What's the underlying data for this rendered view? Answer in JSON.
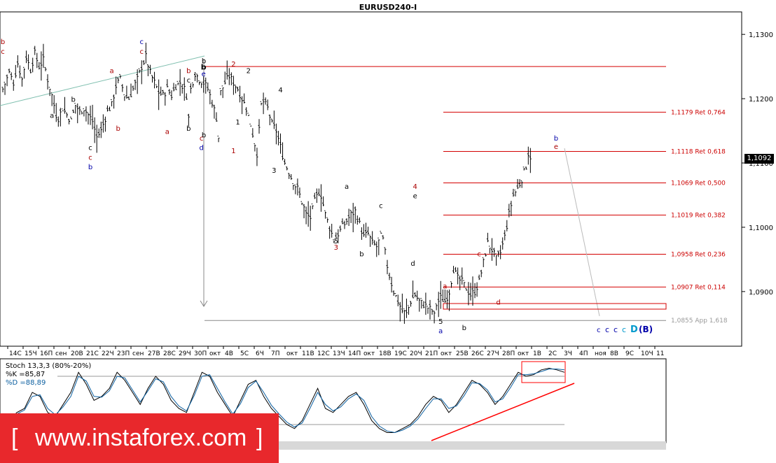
{
  "title": "EURUSD240-I",
  "current_price": "1,1092",
  "banner": {
    "left_bracket": "[",
    "url": "www.instaforex.com",
    "right_bracket": "]"
  },
  "colors": {
    "fib_line": "#d40000",
    "fib_label": "#cc0000",
    "wave_red": "#aa0000",
    "wave_blue": "#0000aa",
    "wave_cyan": "#0099cc",
    "trendline": "#ff0000",
    "channel": "#7fbfaf",
    "candle": "#000000",
    "stoch_k": "#000000",
    "stoch_d": "#0b5fa0",
    "banner_bg": "#e8282c"
  },
  "chart_data": [
    {
      "type": "candlestick",
      "title": "EURUSD240-I",
      "ylim": [
        1.0815,
        1.1335
      ],
      "y_ticks": [
        "1,1300",
        "1,1200",
        "1,1100",
        "1,1000",
        "1,0900"
      ],
      "x_ticks": [
        "14C",
        "15Ч",
        "16П",
        "сен",
        "20В",
        "21С",
        "22Ч",
        "23П",
        "сен",
        "27В",
        "28С",
        "29Ч",
        "30П",
        "окт",
        "4В",
        "5С",
        "6Ч",
        "7П",
        "окт",
        "11В",
        "12С",
        "13Ч",
        "14П",
        "окт",
        "18В",
        "19С",
        "20Ч",
        "21П",
        "окт",
        "25В",
        "26С",
        "27Ч",
        "28П",
        "окт",
        "1В",
        "2С",
        "3Ч",
        "4П",
        "ноя",
        "8В",
        "9С",
        "10Ч",
        "11"
      ],
      "fib_levels": [
        {
          "price": 1.125,
          "label": ""
        },
        {
          "price": 1.1179,
          "label": "1,1179 Ret 0,764"
        },
        {
          "price": 1.1118,
          "label": "1,1118 Ret 0,618"
        },
        {
          "price": 1.1069,
          "label": "1,1069 Ret 0,500"
        },
        {
          "price": 1.1019,
          "label": "1,1019 Ret 0,382"
        },
        {
          "price": 1.0958,
          "label": "1,0958 Ret 0,236"
        },
        {
          "price": 1.0907,
          "label": "1,0907 Ret 0,114"
        },
        {
          "price": 1.0855,
          "label": "1,0855 App 1,618"
        }
      ],
      "close_path": [
        [
          0,
          1.1215
        ],
        [
          3,
          1.124
        ],
        [
          5,
          1.1225
        ],
        [
          7,
          1.1255
        ],
        [
          9,
          1.123
        ],
        [
          11,
          1.1265
        ],
        [
          13,
          1.1245
        ],
        [
          15,
          1.127
        ],
        [
          17,
          1.125
        ],
        [
          19,
          1.126
        ],
        [
          21,
          1.123
        ],
        [
          23,
          1.1205
        ],
        [
          25,
          1.1175
        ],
        [
          26,
          1.117
        ],
        [
          28,
          1.1185
        ],
        [
          30,
          1.1175
        ],
        [
          32,
          1.1165
        ],
        [
          34,
          1.119
        ],
        [
          36,
          1.118
        ],
        [
          38,
          1.1185
        ],
        [
          40,
          1.1175
        ],
        [
          42,
          1.1165
        ],
        [
          44,
          1.114
        ],
        [
          46,
          1.115
        ],
        [
          47,
          1.116
        ],
        [
          49,
          1.118
        ],
        [
          51,
          1.119
        ],
        [
          53,
          1.122
        ],
        [
          55,
          1.123
        ],
        [
          57,
          1.1205
        ],
        [
          59,
          1.12
        ],
        [
          61,
          1.1215
        ],
        [
          63,
          1.123
        ],
        [
          65,
          1.125
        ],
        [
          67,
          1.1265
        ],
        [
          69,
          1.124
        ],
        [
          71,
          1.1225
        ],
        [
          73,
          1.121
        ],
        [
          75,
          1.1205
        ],
        [
          77,
          1.1215
        ],
        [
          79,
          1.1205
        ],
        [
          81,
          1.122
        ],
        [
          83,
          1.1225
        ],
        [
          85,
          1.1215
        ],
        [
          86,
          1.1205
        ],
        [
          87,
          1.117
        ],
        [
          88,
          1.1215
        ],
        [
          90,
          1.124
        ],
        [
          92,
          1.123
        ],
        [
          94,
          1.1225
        ],
        [
          96,
          1.1215
        ],
        [
          98,
          1.1195
        ],
        [
          100,
          1.117
        ],
        [
          101,
          1.114
        ],
        [
          102,
          1.121
        ],
        [
          104,
          1.1225
        ],
        [
          106,
          1.1235
        ],
        [
          108,
          1.1225
        ],
        [
          110,
          1.1215
        ],
        [
          112,
          1.12
        ],
        [
          114,
          1.1185
        ],
        [
          116,
          1.116
        ],
        [
          118,
          1.113
        ],
        [
          119,
          1.1115
        ],
        [
          120,
          1.115
        ],
        [
          121,
          1.119
        ],
        [
          122,
          1.1195
        ],
        [
          124,
          1.1185
        ],
        [
          126,
          1.116
        ],
        [
          128,
          1.115
        ],
        [
          130,
          1.1125
        ],
        [
          132,
          1.11
        ],
        [
          134,
          1.1085
        ],
        [
          136,
          1.107
        ],
        [
          138,
          1.106
        ],
        [
          140,
          1.104
        ],
        [
          142,
          1.102
        ],
        [
          144,
          1.1015
        ],
        [
          146,
          1.104
        ],
        [
          148,
          1.1055
        ],
        [
          149,
          1.105
        ],
        [
          151,
          1.102
        ],
        [
          153,
          1.1
        ],
        [
          155,
          1.098
        ],
        [
          157,
          1.099
        ],
        [
          159,
          1.1
        ],
        [
          161,
          1.101
        ],
        [
          163,
          1.102
        ],
        [
          165,
          1.1025
        ],
        [
          167,
          1.1005
        ],
        [
          169,
          1.0985
        ],
        [
          171,
          1.099
        ],
        [
          173,
          1.0975
        ],
        [
          175,
          1.097
        ],
        [
          177,
          1.0985
        ],
        [
          178,
          1.098
        ],
        [
          180,
          1.094
        ],
        [
          181,
          1.0925
        ],
        [
          183,
          1.09
        ],
        [
          185,
          1.0885
        ],
        [
          187,
          1.087
        ],
        [
          189,
          1.0865
        ],
        [
          191,
          1.0885
        ],
        [
          193,
          1.0895
        ],
        [
          195,
          1.0885
        ],
        [
          197,
          1.088
        ],
        [
          199,
          1.0875
        ],
        [
          201,
          1.087
        ],
        [
          202,
          1.0862
        ],
        [
          203,
          1.088
        ],
        [
          205,
          1.089
        ],
        [
          207,
          1.0885
        ],
        [
          209,
          1.09
        ],
        [
          211,
          1.0935
        ],
        [
          213,
          1.092
        ],
        [
          215,
          1.0915
        ],
        [
          217,
          1.0905
        ],
        [
          219,
          1.0895
        ],
        [
          221,
          1.09
        ],
        [
          223,
          1.0915
        ],
        [
          225,
          1.0945
        ],
        [
          227,
          1.0975
        ],
        [
          229,
          1.0965
        ],
        [
          231,
          1.095
        ],
        [
          233,
          1.096
        ],
        [
          235,
          1.0985
        ],
        [
          237,
          1.102
        ],
        [
          239,
          1.105
        ],
        [
          241,
          1.106
        ],
        [
          243,
          1.1075
        ],
        [
          245,
          1.1095
        ],
        [
          246,
          1.1115
        ],
        [
          247,
          1.111
        ],
        [
          248,
          1.1095
        ]
      ],
      "annotations": [
        {
          "text": "b",
          "bar": 0,
          "price": 1.1285,
          "color": "#aa0000"
        },
        {
          "text": "c",
          "bar": 0,
          "price": 1.127,
          "color": "#aa0000"
        },
        {
          "text": "b",
          "bar": -13,
          "price": 1.1255,
          "color": "#000000"
        },
        {
          "text": "b",
          "bar": -13,
          "price": 1.114,
          "color": "#000000"
        },
        {
          "text": "a",
          "bar": 23,
          "price": 1.117,
          "color": "#000000"
        },
        {
          "text": "b",
          "bar": 33,
          "price": 1.1195,
          "color": "#000000"
        },
        {
          "text": "c",
          "bar": 41,
          "price": 1.112,
          "color": "#000000"
        },
        {
          "text": "c",
          "bar": 41,
          "price": 1.1105,
          "color": "#aa0000"
        },
        {
          "text": "b",
          "bar": 41,
          "price": 1.109,
          "color": "#0000aa"
        },
        {
          "text": "a",
          "bar": 51,
          "price": 1.124,
          "color": "#aa0000"
        },
        {
          "text": "b",
          "bar": 54,
          "price": 1.115,
          "color": "#aa0000"
        },
        {
          "text": "c",
          "bar": 65,
          "price": 1.1285,
          "color": "#0000aa"
        },
        {
          "text": "c",
          "bar": 65,
          "price": 1.127,
          "color": "#aa0000"
        },
        {
          "text": "a",
          "bar": 77,
          "price": 1.1145,
          "color": "#aa0000"
        },
        {
          "text": "b",
          "bar": 87,
          "price": 1.115,
          "color": "#000000"
        },
        {
          "text": "b",
          "bar": 87,
          "price": 1.124,
          "color": "#aa0000"
        },
        {
          "text": "c",
          "bar": 87,
          "price": 1.1225,
          "color": "#000000"
        },
        {
          "text": "b",
          "bar": 94,
          "price": 1.1245,
          "color": "#000000",
          "bold": true
        },
        {
          "text": "e",
          "bar": 94,
          "price": 1.1235,
          "color": "#0000aa"
        },
        {
          "text": "c",
          "bar": 93,
          "price": 1.1135,
          "color": "#aa0000"
        },
        {
          "text": "d",
          "bar": 93,
          "price": 1.112,
          "color": "#0000aa"
        },
        {
          "text": "2",
          "bar": 108,
          "price": 1.125,
          "color": "#aa0000"
        },
        {
          "text": "2",
          "bar": 115,
          "price": 1.124,
          "color": "#000000"
        },
        {
          "text": "1",
          "bar": 110,
          "price": 1.116,
          "color": "#000000"
        },
        {
          "text": "1",
          "bar": 108,
          "price": 1.1115,
          "color": "#aa0000"
        },
        {
          "text": "4",
          "bar": 130,
          "price": 1.121,
          "color": "#000000"
        },
        {
          "text": "3",
          "bar": 127,
          "price": 1.1085,
          "color": "#000000"
        },
        {
          "text": "a",
          "bar": 161,
          "price": 1.106,
          "color": "#000000"
        },
        {
          "text": "5",
          "bar": 156,
          "price": 1.0975,
          "color": "#000000"
        },
        {
          "text": "3",
          "bar": 156,
          "price": 1.0965,
          "color": "#aa0000"
        },
        {
          "text": "b",
          "bar": 168,
          "price": 1.0955,
          "color": "#000000"
        },
        {
          "text": "c",
          "bar": 177,
          "price": 1.103,
          "color": "#000000"
        },
        {
          "text": "4",
          "bar": 193,
          "price": 1.106,
          "color": "#aa0000"
        },
        {
          "text": "e",
          "bar": 193,
          "price": 1.1045,
          "color": "#000000"
        },
        {
          "text": "d",
          "bar": 192,
          "price": 1.094,
          "color": "#000000"
        },
        {
          "text": "a",
          "bar": 207,
          "price": 1.0905,
          "color": "#aa0000"
        },
        {
          "text": "5",
          "bar": 205,
          "price": 1.085,
          "color": "#000000"
        },
        {
          "text": "a",
          "bar": 205,
          "price": 1.0835,
          "color": "#0000aa"
        },
        {
          "text": "b",
          "bar": 216,
          "price": 1.084,
          "color": "#000000"
        },
        {
          "text": "c",
          "bar": 223,
          "price": 1.0955,
          "color": "#aa0000"
        },
        {
          "text": "d",
          "bar": 232,
          "price": 1.088,
          "color": "#aa0000"
        },
        {
          "text": "b",
          "bar": 259,
          "price": 1.1135,
          "color": "#0000aa"
        },
        {
          "text": "e",
          "bar": 259,
          "price": 1.1122,
          "color": "#aa0000"
        }
      ],
      "future_labels": [
        {
          "text": "c",
          "color": "#0000aa",
          "size": 10
        },
        {
          "text": "c",
          "color": "#0000aa",
          "size": 11
        },
        {
          "text": "c",
          "color": "#0000aa",
          "size": 11
        },
        {
          "text": "c",
          "color": "#0099cc",
          "size": 11
        },
        {
          "text": "D",
          "color": "#0099cc",
          "size": 13
        },
        {
          "text": "(B)",
          "color": "#0000aa",
          "size": 12
        }
      ]
    },
    {
      "type": "line",
      "title": "Stoch 13,3,3 (80%-20%)",
      "ylim": [
        0,
        100
      ],
      "levels": [
        80,
        20
      ],
      "series": [
        {
          "name": "%K =85,87",
          "values": [
            30,
            25,
            35,
            40,
            60,
            55,
            35,
            30,
            45,
            60,
            85,
            70,
            50,
            55,
            65,
            85,
            75,
            60,
            45,
            65,
            80,
            70,
            50,
            40,
            35,
            60,
            85,
            80,
            60,
            45,
            30,
            50,
            70,
            75,
            55,
            40,
            30,
            20,
            15,
            25,
            45,
            65,
            40,
            35,
            45,
            55,
            60,
            45,
            25,
            15,
            10,
            10,
            15,
            20,
            30,
            45,
            55,
            50,
            35,
            45,
            60,
            75,
            70,
            60,
            45,
            55,
            70,
            85,
            80,
            82,
            88,
            90,
            88,
            85
          ]
        },
        {
          "name": "%D =88,89",
          "values": [
            32,
            28,
            33,
            38,
            55,
            57,
            40,
            32,
            42,
            55,
            80,
            74,
            55,
            54,
            62,
            80,
            78,
            63,
            48,
            62,
            77,
            73,
            55,
            43,
            37,
            56,
            80,
            82,
            65,
            48,
            33,
            46,
            66,
            74,
            60,
            44,
            33,
            23,
            17,
            22,
            40,
            60,
            45,
            37,
            42,
            52,
            58,
            50,
            30,
            18,
            12,
            10,
            13,
            18,
            27,
            40,
            52,
            52,
            40,
            43,
            56,
            72,
            71,
            63,
            48,
            52,
            66,
            82,
            82,
            83,
            86,
            89,
            89,
            88
          ]
        }
      ]
    }
  ]
}
